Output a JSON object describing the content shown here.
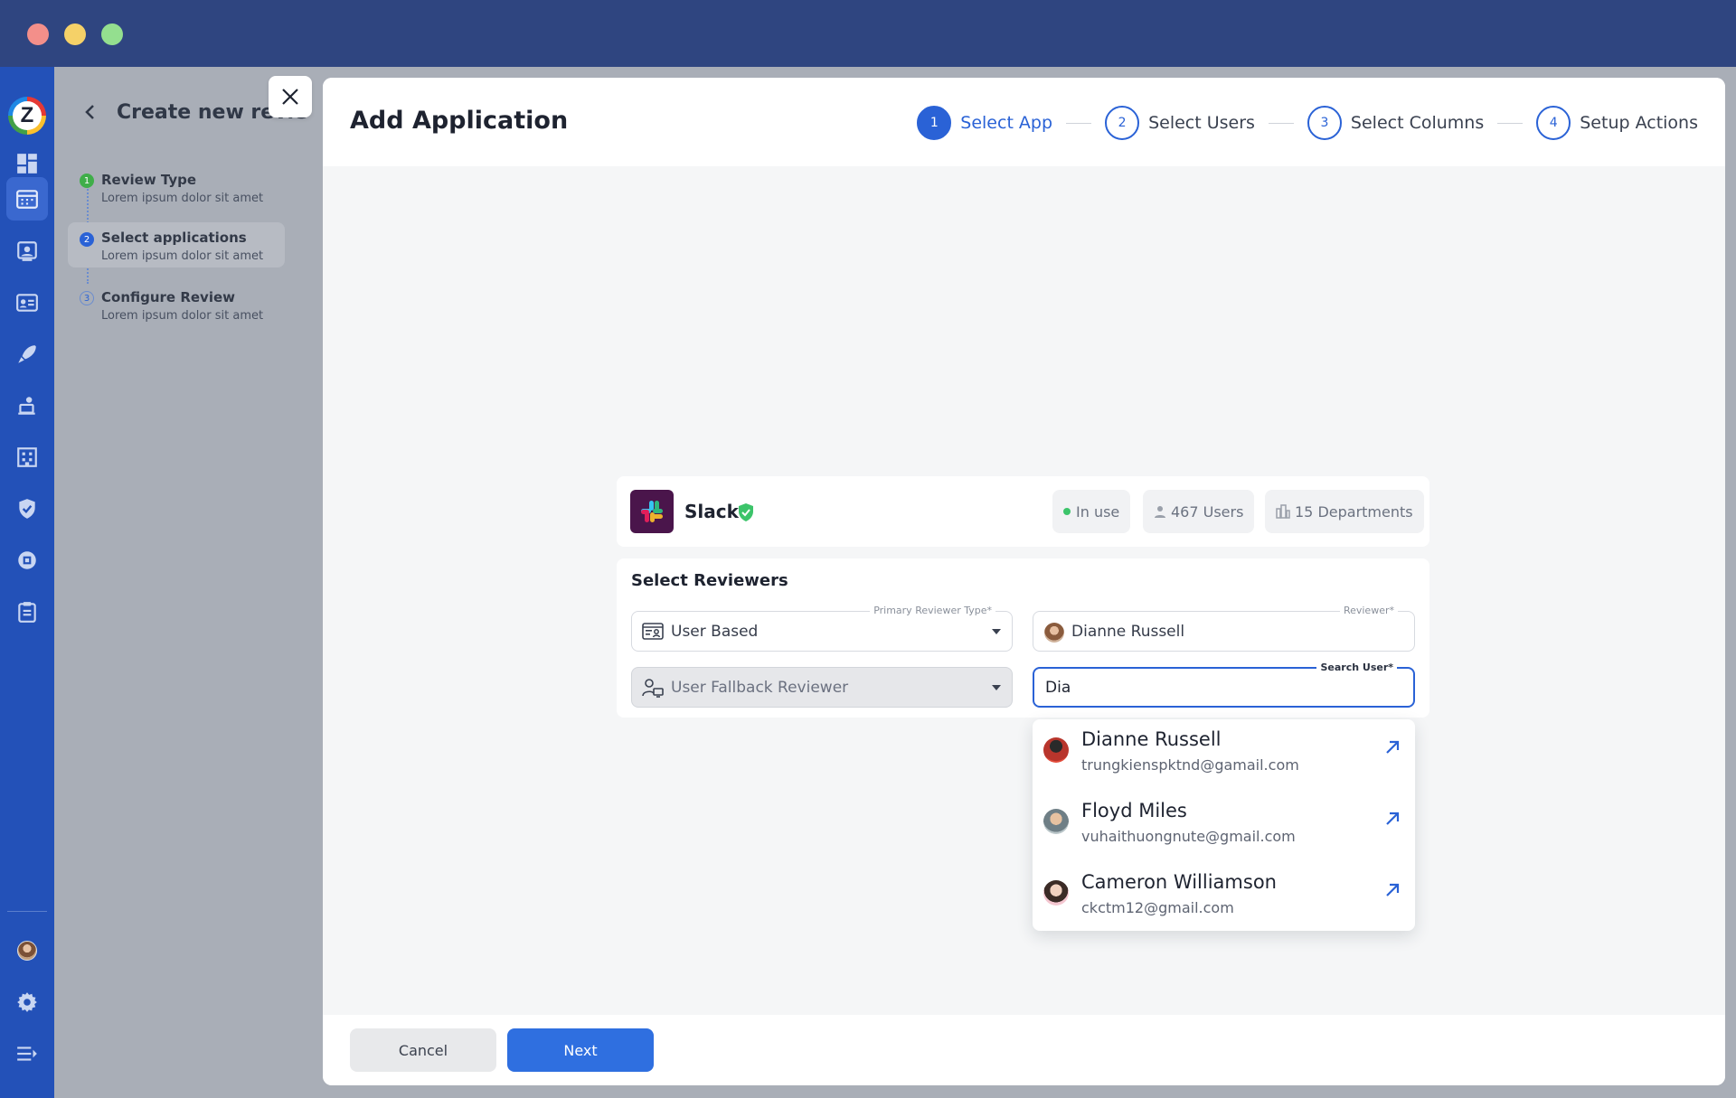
{
  "window": {
    "controls": [
      "close",
      "minimize",
      "maximize"
    ]
  },
  "rail": {
    "logo_letter": "Z",
    "icons": [
      "dashboard-icon",
      "calendar-icon",
      "contact-card-icon",
      "id-card-icon",
      "rocket-icon",
      "user-laptop-icon",
      "building-icon",
      "shield-check-icon",
      "chip-icon",
      "clipboard-icon"
    ],
    "active_index": 1,
    "bottom_icons": [
      "user-avatar",
      "settings-icon",
      "menu-collapse-icon"
    ]
  },
  "wizard": {
    "title": "Create new review",
    "steps": [
      {
        "number": "1",
        "label": "Review Type",
        "sub": "Lorem ipsum dolor sit amet",
        "state": "done",
        "color": "#3fae49"
      },
      {
        "number": "2",
        "label": "Select applications",
        "sub": "Lorem ipsum dolor sit amet",
        "state": "active",
        "color": "#2a62d6"
      },
      {
        "number": "3",
        "label": "Configure Review",
        "sub": "Lorem ipsum dolor sit amet",
        "state": "pending",
        "color": "#6a8ccf"
      }
    ]
  },
  "modal": {
    "title": "Add Application",
    "steps": [
      {
        "number": "1",
        "label": "Select App",
        "active": true
      },
      {
        "number": "2",
        "label": "Select Users",
        "active": false
      },
      {
        "number": "3",
        "label": "Select Columns",
        "active": false
      },
      {
        "number": "4",
        "label": "Setup Actions",
        "active": false
      }
    ],
    "app": {
      "name": "Slack",
      "status": "In use",
      "users": "467 Users",
      "departments": "15 Departments"
    },
    "reviewers": {
      "title": "Select Reviewers",
      "primary_type_label": "Primary Reviewer Type*",
      "primary_type_value": "User Based",
      "reviewer_label": "Reviewer*",
      "reviewer_value": "Dianne Russell",
      "fallback_value": "User Fallback Reviewer",
      "search_label": "Search User*",
      "search_value": "Dia"
    },
    "search_results": [
      {
        "name": "Dianne Russell",
        "email": "trungkienspktnd@gamail.com"
      },
      {
        "name": "Floyd Miles",
        "email": "vuhaithuongnute@gmail.com"
      },
      {
        "name": "Cameron Williamson",
        "email": "ckctm12@gmail.com"
      }
    ],
    "footer": {
      "cancel": "Cancel",
      "next": "Next"
    }
  },
  "colors": {
    "accent": "#2a62d6",
    "rail": "#2351b8",
    "titlebar": "#2f4580",
    "success": "#3cc46a",
    "slack_bg": "#4a154b"
  }
}
